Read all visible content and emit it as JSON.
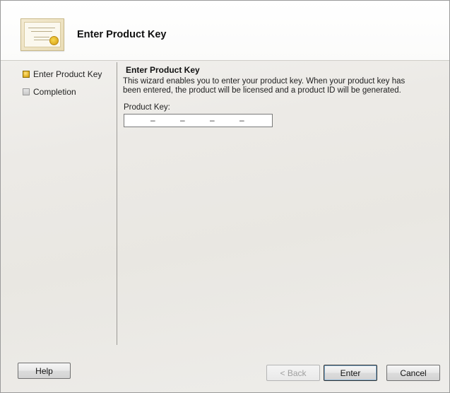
{
  "header": {
    "title": "Enter Product Key"
  },
  "nav": {
    "items": [
      {
        "label": "Enter Product Key",
        "state": "active"
      },
      {
        "label": "Completion",
        "state": "pending"
      }
    ]
  },
  "main": {
    "section_title": "Enter Product Key",
    "description": "This wizard enables you to enter your product key. When your product key has been entered, the product will be licensed and a product ID will be generated.",
    "product_key_label": "Product Key:",
    "product_key_value": "",
    "separator": "–"
  },
  "buttons": {
    "help": "Help",
    "back": "< Back",
    "enter": "Enter",
    "cancel": "Cancel"
  },
  "icons": {
    "header": "certificate-icon",
    "nav_active": "current-step-icon",
    "nav_inactive": "pending-step-icon"
  },
  "colors": {
    "active_step": "#d39a00",
    "inactive_step": "#c9c9c9"
  }
}
